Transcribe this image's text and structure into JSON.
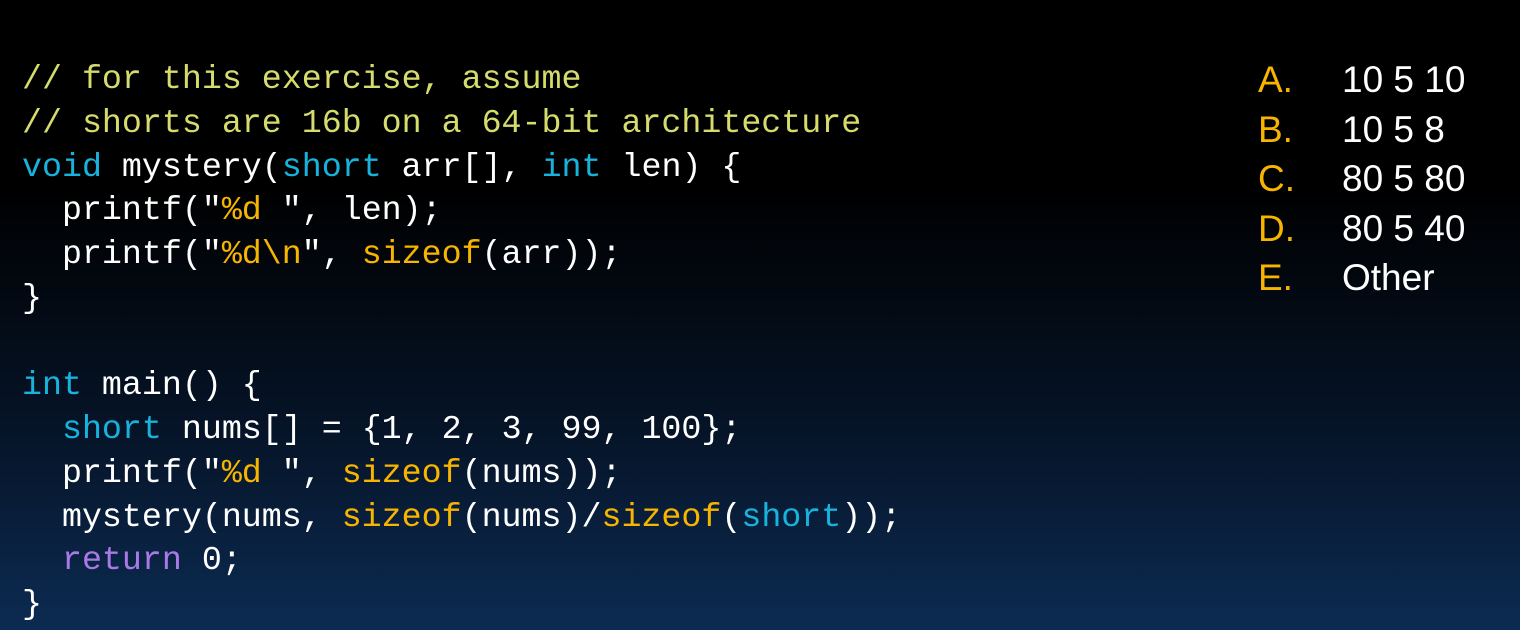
{
  "colors": {
    "comment": "#d6dc6c",
    "keyword": "#17b3dc",
    "func": "#f7b500",
    "return": "#a77ae6",
    "text": "#ffffff"
  },
  "code": [
    [
      [
        "comment",
        "// for this exercise, assume"
      ]
    ],
    [
      [
        "comment",
        "// shorts are 16b on a 64-bit architecture"
      ]
    ],
    [
      [
        "keyword",
        "void"
      ],
      [
        "plain",
        " mystery("
      ],
      [
        "keyword",
        "short"
      ],
      [
        "plain",
        " arr[], "
      ],
      [
        "keyword",
        "int"
      ],
      [
        "plain",
        " len) {"
      ]
    ],
    [
      [
        "plain",
        "  printf(\""
      ],
      [
        "fmt",
        "%d"
      ],
      [
        "plain",
        " \", len);"
      ]
    ],
    [
      [
        "plain",
        "  printf(\""
      ],
      [
        "fmt",
        "%d\\n"
      ],
      [
        "plain",
        "\", "
      ],
      [
        "func",
        "sizeof"
      ],
      [
        "plain",
        "(arr));"
      ]
    ],
    [
      [
        "plain",
        "}"
      ]
    ],
    [
      [
        "plain",
        " "
      ]
    ],
    [
      [
        "keyword",
        "int"
      ],
      [
        "plain",
        " main() {"
      ]
    ],
    [
      [
        "plain",
        "  "
      ],
      [
        "keyword",
        "short"
      ],
      [
        "plain",
        " nums[] = {1, 2, 3, 99, 100};"
      ]
    ],
    [
      [
        "plain",
        "  printf(\""
      ],
      [
        "fmt",
        "%d"
      ],
      [
        "plain",
        " \", "
      ],
      [
        "func",
        "sizeof"
      ],
      [
        "plain",
        "(nums));"
      ]
    ],
    [
      [
        "plain",
        "  mystery(nums, "
      ],
      [
        "func",
        "sizeof"
      ],
      [
        "plain",
        "(nums)/"
      ],
      [
        "func",
        "sizeof"
      ],
      [
        "plain",
        "("
      ],
      [
        "keyword",
        "short"
      ],
      [
        "plain",
        "));"
      ]
    ],
    [
      [
        "plain",
        "  "
      ],
      [
        "ret",
        "return"
      ],
      [
        "plain",
        " 0;"
      ]
    ],
    [
      [
        "plain",
        "}"
      ]
    ]
  ],
  "answers": [
    {
      "letter": "A.",
      "value": "10 5 10"
    },
    {
      "letter": "B.",
      "value": "10 5 8"
    },
    {
      "letter": "C.",
      "value": "80 5 80"
    },
    {
      "letter": "D.",
      "value": "80 5 40"
    },
    {
      "letter": "E.",
      "value": "Other"
    }
  ]
}
